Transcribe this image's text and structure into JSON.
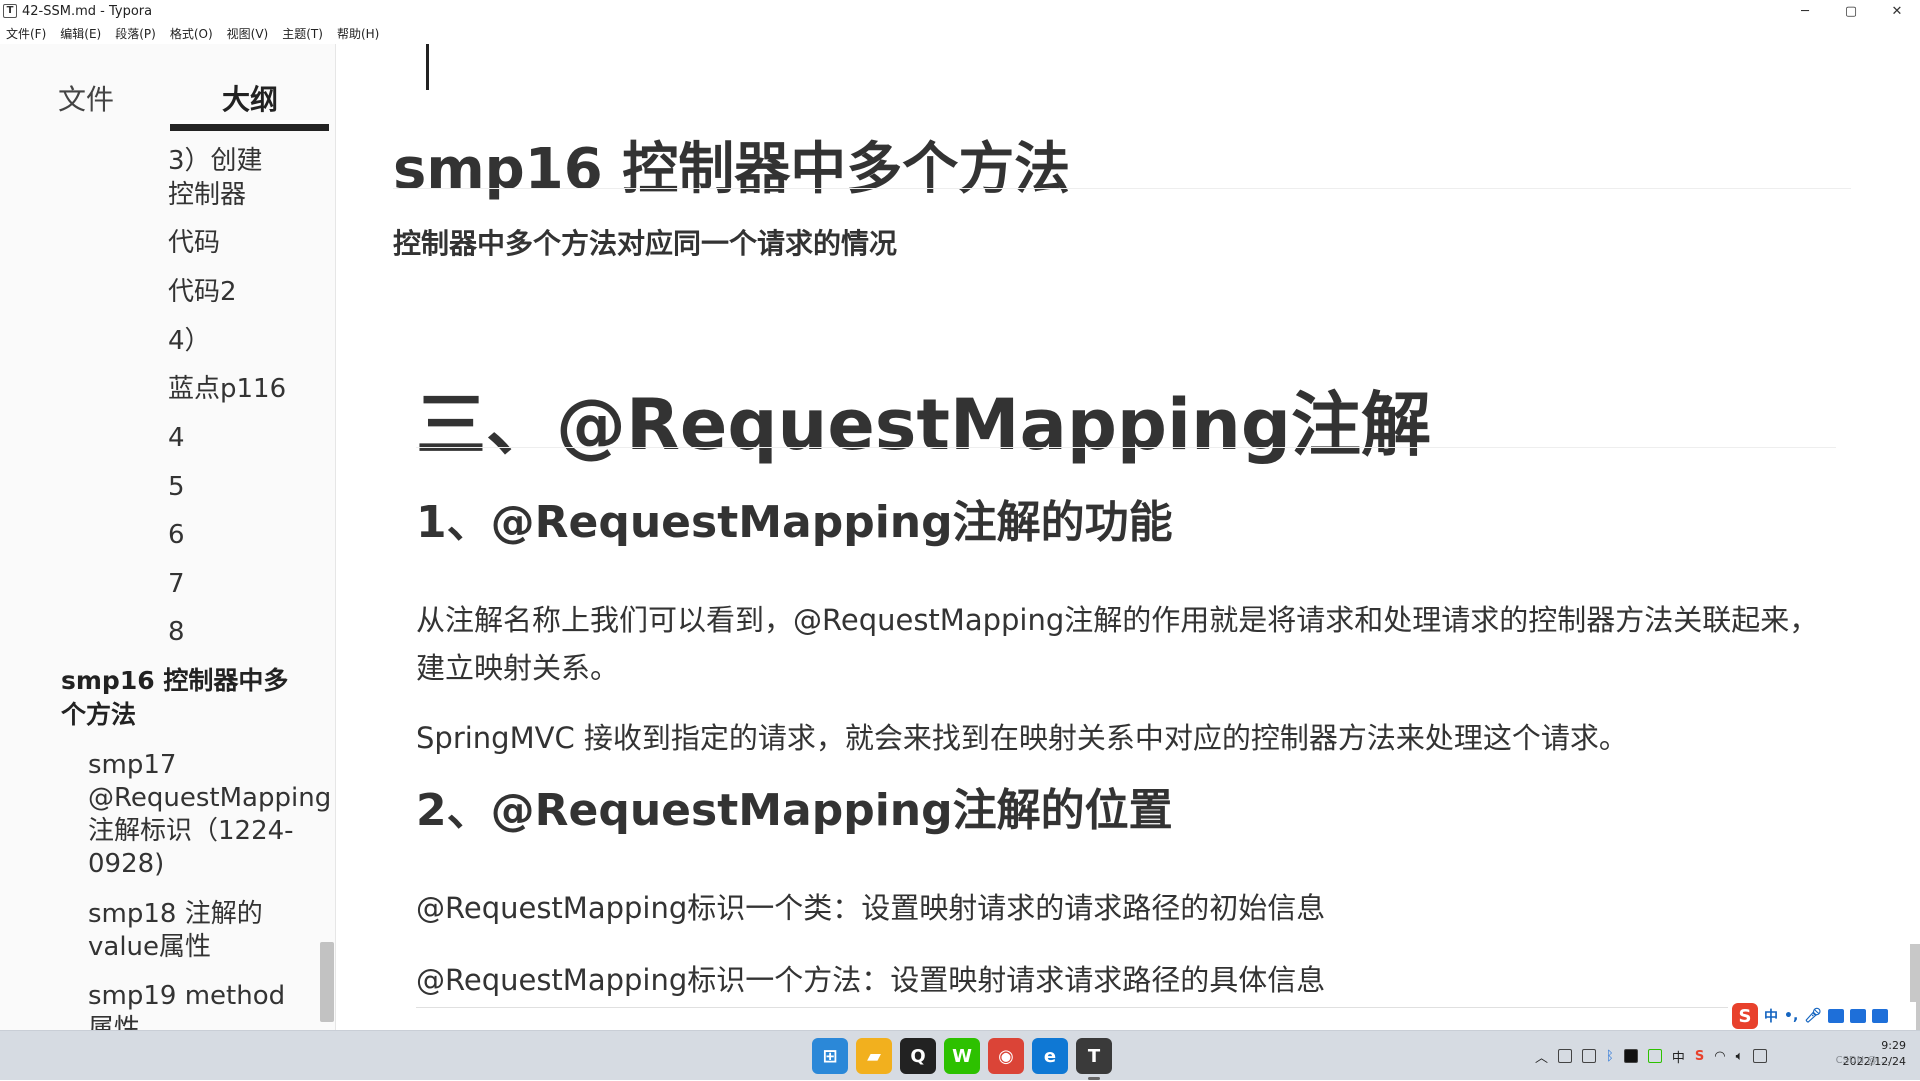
{
  "window": {
    "title": "42-SSM.md - Typora",
    "app_icon_letter": "T",
    "controls": {
      "minimize": "─",
      "maximize": "▢",
      "close": "✕"
    }
  },
  "menu": [
    "文件(F)",
    "编辑(E)",
    "段落(P)",
    "格式(O)",
    "视图(V)",
    "主题(T)",
    "帮助(H)"
  ],
  "sidebar": {
    "tab_files": "文件",
    "tab_outline": "大纲",
    "outline": [
      {
        "text": "3）创建"
      },
      {
        "text": "控制器"
      },
      {
        "text": "代码"
      },
      {
        "text": "代码2"
      },
      {
        "text": "4）"
      },
      {
        "text": "蓝点p116"
      },
      {
        "text": "4"
      },
      {
        "text": "5"
      },
      {
        "text": "6"
      },
      {
        "text": "7"
      },
      {
        "text": "8"
      },
      {
        "text": "smp16 控制器中多"
      },
      {
        "text": "个方法"
      },
      {
        "text": "smp17"
      },
      {
        "text": "@RequestMapping"
      },
      {
        "text": "注解标识（1224-"
      },
      {
        "text": "0928)"
      },
      {
        "text": "smp18 注解的"
      },
      {
        "text": "value属性"
      },
      {
        "text": "smp19 method"
      },
      {
        "text": "属性"
      }
    ]
  },
  "editor": {
    "heading_smp16": "smp16  控制器中多个方法",
    "bold_line": "控制器中多个方法对应同一个请求的情况",
    "h1": "三、@RequestMapping注解",
    "h2_1": "1、@RequestMapping注解的功能",
    "p1_line1": "从注解名称上我们可以看到，@RequestMapping注解的作用就是将请求和处理请求的控制器方法关联起来，",
    "p1_line2": "建立映射关系。",
    "p2": "SpringMVC 接收到指定的请求，就会来找到在映射关系中对应的控制器方法来处理这个请求。",
    "h2_2": "2、@RequestMapping注解的位置",
    "p3": "@RequestMapping标识一个类：设置映射请求的请求路径的初始信息",
    "p4": "@RequestMapping标识一个方法：设置映射请求请求路径的具体信息"
  },
  "ime": {
    "logo": "S",
    "mode": "中",
    "punct": "•,"
  },
  "taskbar": {
    "apps": [
      {
        "name": "start",
        "label": "⊞",
        "color": "#2b88d8"
      },
      {
        "name": "explorer",
        "label": "▰",
        "color": "#f2b01e"
      },
      {
        "name": "qq",
        "label": "Q",
        "color": "#222222"
      },
      {
        "name": "wechat",
        "label": "W",
        "color": "#2dc100"
      },
      {
        "name": "chrome",
        "label": "◉",
        "color": "#db4437"
      },
      {
        "name": "edge",
        "label": "e",
        "color": "#0f78d4"
      },
      {
        "name": "typora",
        "label": "T",
        "color": "#3a3a3a"
      }
    ],
    "tray_lang": "中",
    "time": "9:29",
    "date": "2022/12/24",
    "watermark": "CSDN @ ..."
  }
}
